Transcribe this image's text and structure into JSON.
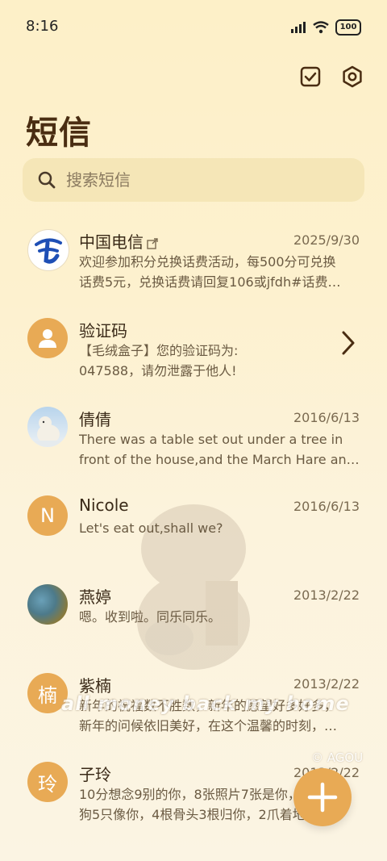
{
  "status": {
    "time": "8:16",
    "battery": "100"
  },
  "page": {
    "title": "短信"
  },
  "search": {
    "placeholder": "搜索短信"
  },
  "colors": {
    "accent": "#e8aa55",
    "background": "#fdf0c8",
    "title": "#4a2d12"
  },
  "conversations": [
    {
      "name": "中国电信",
      "date": "2025/9/30",
      "preview": [
        "欢迎参加积分兑换话费活动，每500分可兑换",
        "话费5元，兑换话费请回复106或jfdh#话费…"
      ],
      "avatar": "china-telecom-logo"
    },
    {
      "name": "验证码",
      "date": "",
      "preview": [
        "【毛绒盒子】您的验证码为:",
        "047588，请勿泄露于他人!"
      ],
      "avatar": "person-icon"
    },
    {
      "name": "倩倩",
      "date": "2016/6/13",
      "preview": [
        "There was a table set out under a tree in",
        "front of the house,and the March Hare an…"
      ],
      "avatar": "polar-bear-photo"
    },
    {
      "name": "Nicole",
      "date": "2016/6/13",
      "preview": [
        "Let's eat out,shall we?"
      ],
      "avatar_letter": "N"
    },
    {
      "name": "燕婷",
      "date": "2013/2/22",
      "preview": [
        "嗯。收到啦。同乐同乐。"
      ],
      "avatar": "landscape-photo"
    },
    {
      "name": "紫楠",
      "date": "2013/2/22",
      "preview": [
        "新年的祝福数不胜数，新年的愿望好多好多，",
        "新年的问候依旧美好，在这个温馨的时刻，…"
      ],
      "avatar_letter": "楠"
    },
    {
      "name": "子玲",
      "date": "2013/2/22",
      "preview": [
        "10分想念9别的你，8张照片7张是你，6只小",
        "狗5只像你，4根骨头3根归你，2爪着地1寅…"
      ],
      "avatar_letter": "玲"
    }
  ],
  "watermark": {
    "text": "all money back my home",
    "credit": "© AGOU"
  }
}
